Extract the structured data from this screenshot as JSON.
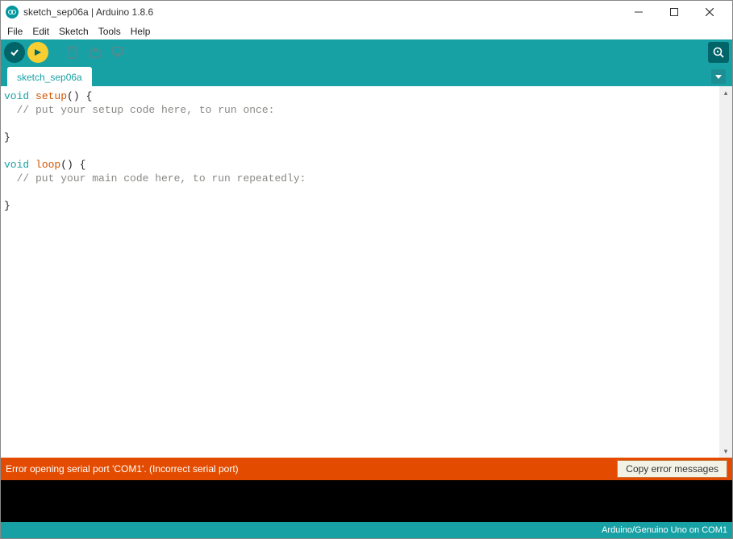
{
  "window": {
    "title": "sketch_sep06a | Arduino 1.8.6"
  },
  "menu": {
    "items": [
      "File",
      "Edit",
      "Sketch",
      "Tools",
      "Help"
    ]
  },
  "tabs": {
    "active": "sketch_sep06a"
  },
  "editor": {
    "lines": [
      {
        "type": "sig",
        "void": "void",
        "fn": "setup",
        "rest": "() {"
      },
      {
        "type": "comment",
        "text": "  // put your setup code here, to run once:"
      },
      {
        "type": "blank",
        "text": ""
      },
      {
        "type": "plain",
        "text": "}"
      },
      {
        "type": "blank",
        "text": ""
      },
      {
        "type": "sig",
        "void": "void",
        "fn": "loop",
        "rest": "() {"
      },
      {
        "type": "comment",
        "text": "  // put your main code here, to run repeatedly:"
      },
      {
        "type": "blank",
        "text": ""
      },
      {
        "type": "plain",
        "text": "}"
      }
    ]
  },
  "error": {
    "message": "Error opening serial port 'COM1'. (Incorrect serial port)",
    "copy_label": "Copy error messages"
  },
  "status": {
    "board": "Arduino/Genuino Uno on COM1"
  }
}
